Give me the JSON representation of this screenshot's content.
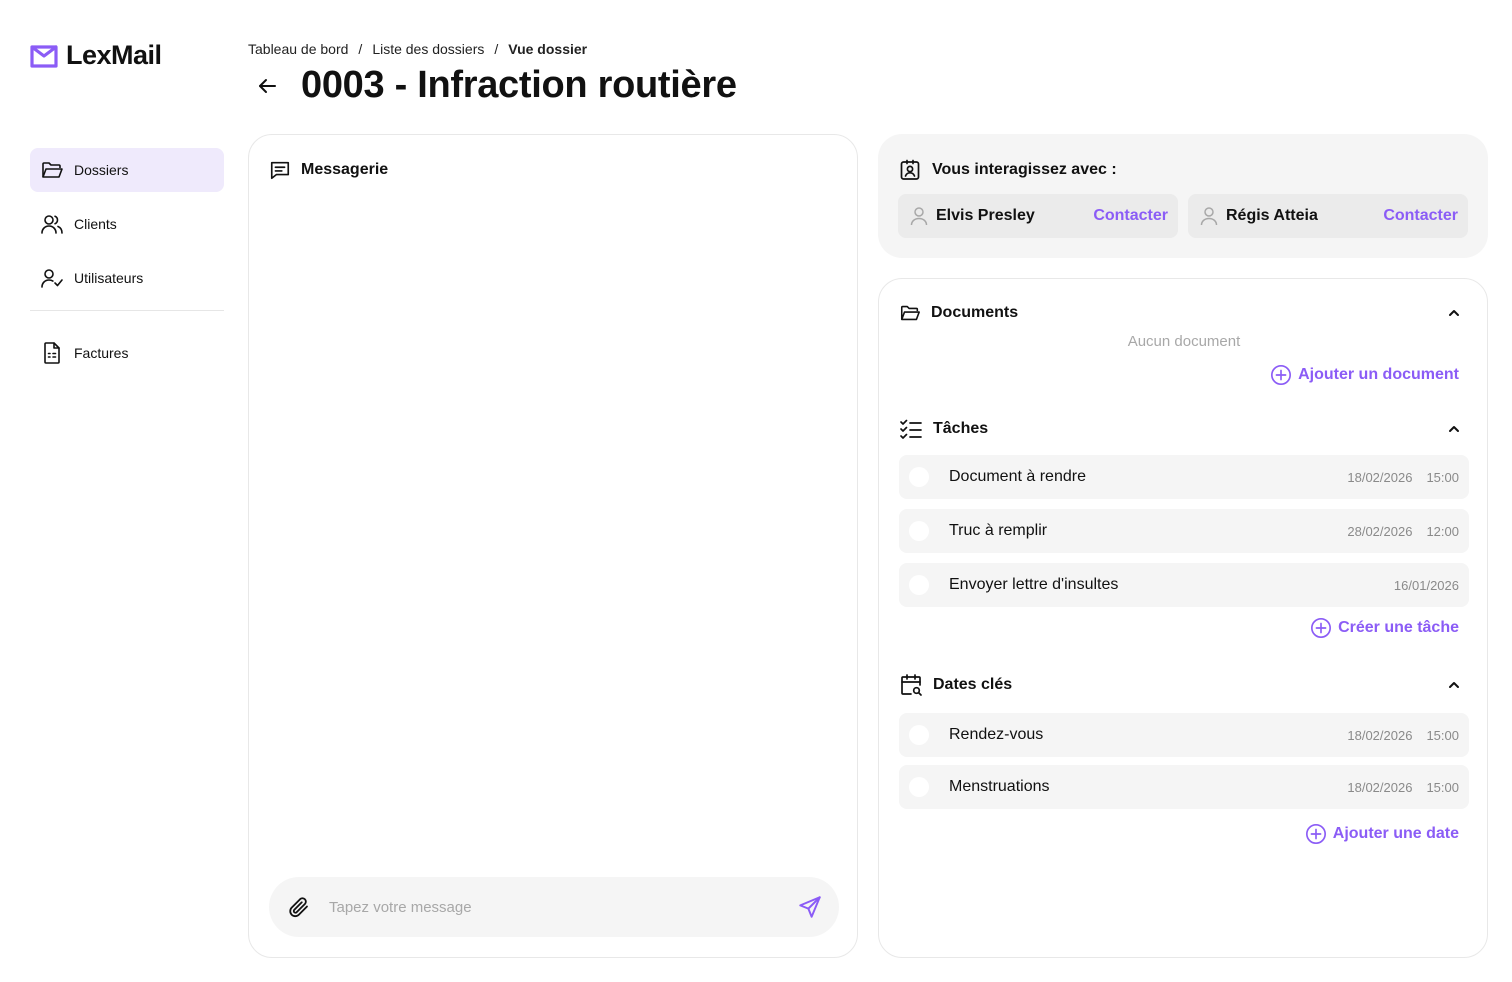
{
  "app": {
    "name": "LexMail"
  },
  "sidebar": {
    "items": [
      {
        "label": "Dossiers",
        "icon": "folder-icon",
        "active": true
      },
      {
        "label": "Clients",
        "icon": "users-icon"
      },
      {
        "label": "Utilisateurs",
        "icon": "user-check-icon"
      }
    ],
    "secondary": [
      {
        "label": "Factures",
        "icon": "invoice-icon"
      }
    ]
  },
  "breadcrumb": {
    "items": [
      "Tableau de bord",
      "Liste des dossiers"
    ],
    "current": "Vue dossier",
    "separator": "/"
  },
  "page": {
    "title": "0003 - Infraction routière"
  },
  "messagerie": {
    "title": "Messagerie",
    "placeholder": "Tapez votre message"
  },
  "interact": {
    "title": "Vous interagissez avec :",
    "contacts": [
      {
        "name": "Elvis Presley",
        "action": "Contacter"
      },
      {
        "name": "Régis Atteia",
        "action": "Contacter"
      }
    ]
  },
  "documents": {
    "title": "Documents",
    "empty": "Aucun document",
    "add_label": "Ajouter un document"
  },
  "taches": {
    "title": "Tâches",
    "items": [
      {
        "label": "Document à rendre",
        "date": "18/02/2026",
        "time": "15:00"
      },
      {
        "label": "Truc à remplir",
        "date": "28/02/2026",
        "time": "12:00"
      },
      {
        "label": "Envoyer lettre d'insultes",
        "date": "16/01/2026",
        "time": ""
      }
    ],
    "add_label": "Créer une tâche"
  },
  "dates": {
    "title": "Dates clés",
    "items": [
      {
        "label": "Rendez-vous",
        "date": "18/02/2026",
        "time": "15:00"
      },
      {
        "label": "Menstruations",
        "date": "18/02/2026",
        "time": "15:00"
      }
    ],
    "add_label": "Ajouter une date"
  },
  "colors": {
    "accent": "#8b5cf6",
    "active_bg": "#efeafc",
    "panel_bg": "#f5f5f5"
  }
}
